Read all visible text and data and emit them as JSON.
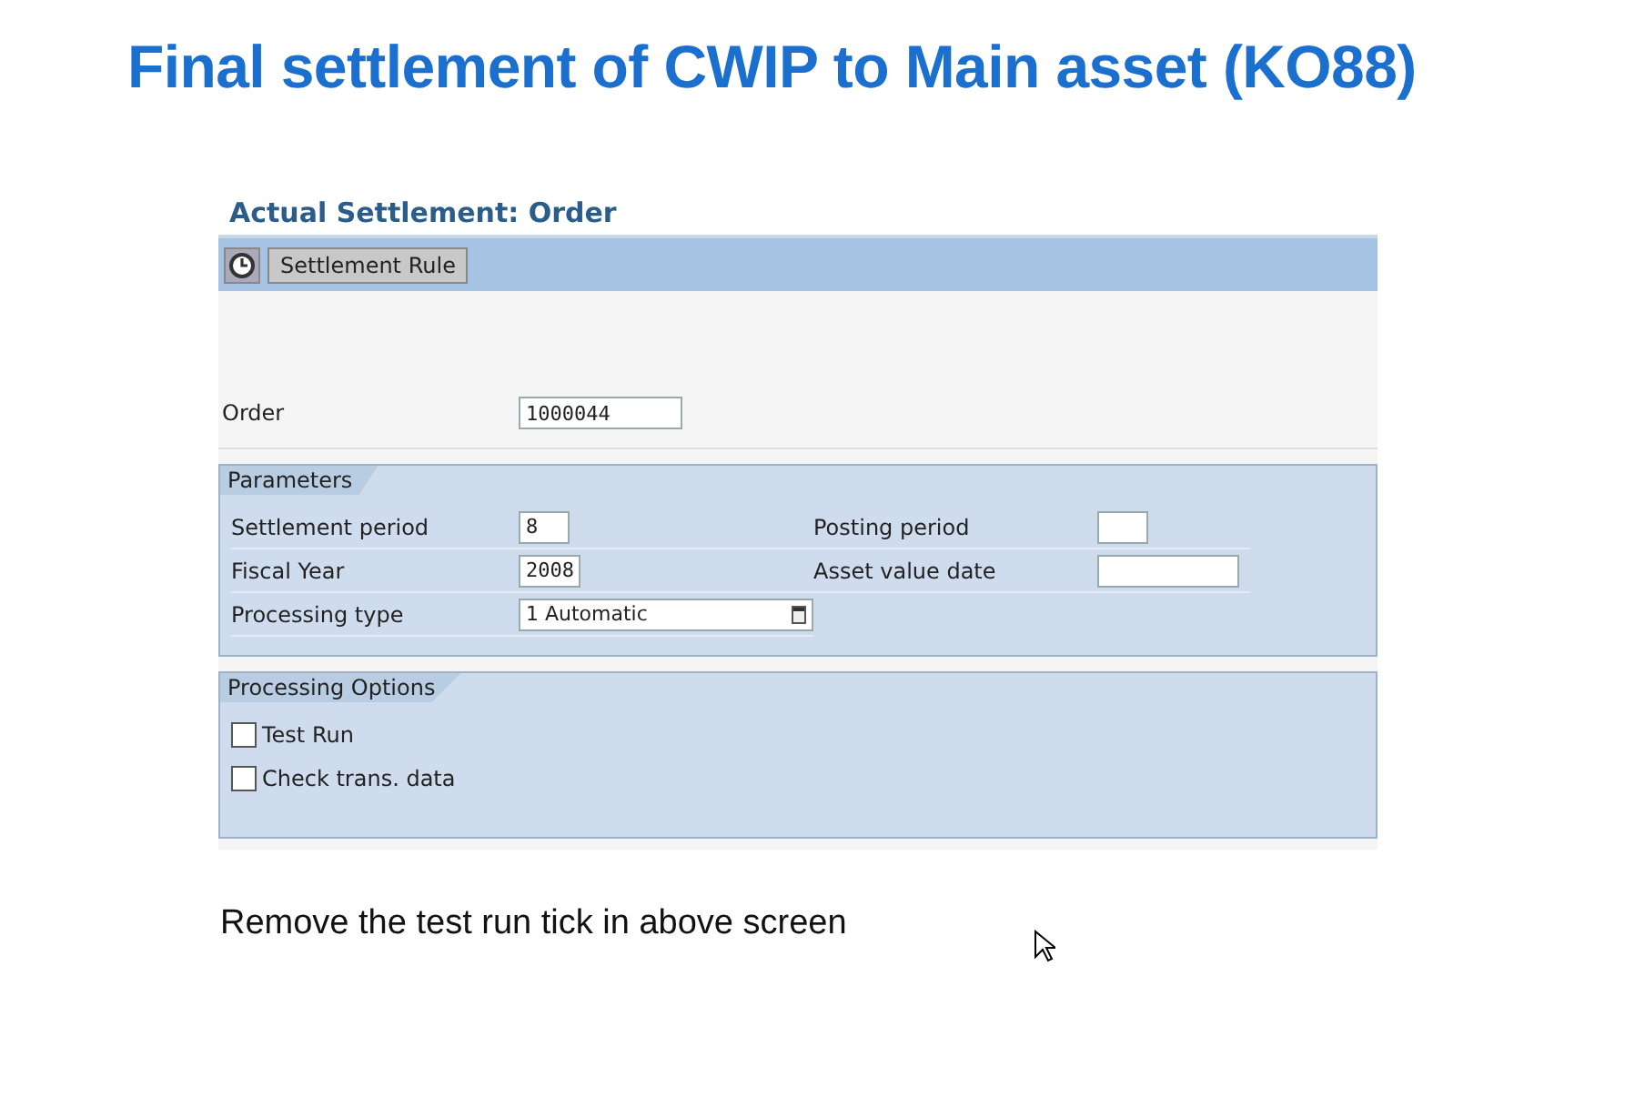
{
  "slide_title": "Final settlement of CWIP to Main asset (KO88)",
  "screen": {
    "title": "Actual Settlement: Order",
    "toolbar": {
      "button": "Settlement Rule"
    },
    "order": {
      "label": "Order",
      "value": "1000044"
    },
    "parameters": {
      "title": "Parameters",
      "left": [
        {
          "label": "Settlement period",
          "value": "8",
          "kind": "period"
        },
        {
          "label": "Fiscal Year",
          "value": "2008",
          "kind": "year"
        },
        {
          "label": "Processing type",
          "value": "1 Automatic",
          "kind": "dropdown"
        }
      ],
      "right": [
        {
          "label": "Posting period",
          "kind": "period"
        },
        {
          "label": "Asset value date",
          "kind": "date"
        }
      ]
    },
    "options": {
      "title": "Processing Options",
      "items": [
        {
          "label": "Test Run",
          "checked": false
        },
        {
          "label": "Check trans. data",
          "checked": false
        }
      ]
    }
  },
  "caption": "Remove the test run tick in above screen"
}
